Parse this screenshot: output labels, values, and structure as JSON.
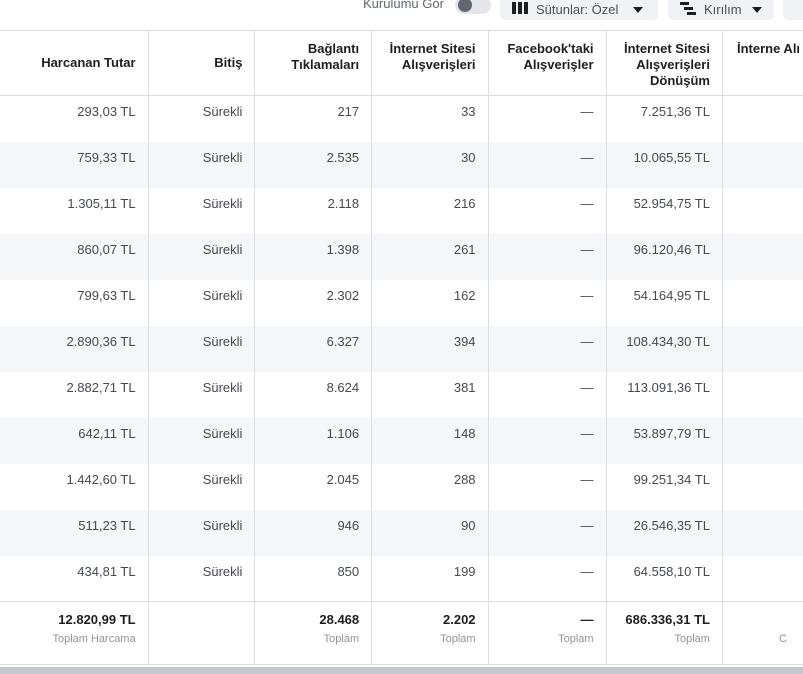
{
  "toolbar": {
    "setup_label": "Kurulumu Gör",
    "columns_label": "Sütunlar: Özel",
    "breakdown_label": "Kırılım",
    "columns_icon": "columns-icon",
    "breakdown_icon": "breakdown-icon"
  },
  "table": {
    "headers": [
      "Harcanan Tutar",
      "Bitiş",
      "Bağlantı Tıklamaları",
      "İnternet Sitesi Alışverişleri",
      "Facebook'taki Alışverişler",
      "İnternet Sitesi Alışverişleri Dönüşüm",
      "İnterne Alı F"
    ],
    "rows": [
      [
        "293,03 TL",
        "Sürekli",
        "217",
        "33",
        "—",
        "7.251,36 TL",
        ""
      ],
      [
        "759,33 TL",
        "Sürekli",
        "2.535",
        "30",
        "—",
        "10.065,55 TL",
        ""
      ],
      [
        "1.305,11 TL",
        "Sürekli",
        "2.118",
        "216",
        "—",
        "52.954,75 TL",
        ""
      ],
      [
        "860,07 TL",
        "Sürekli",
        "1.398",
        "261",
        "—",
        "96.120,46 TL",
        ""
      ],
      [
        "799,63 TL",
        "Sürekli",
        "2.302",
        "162",
        "—",
        "54.164,95 TL",
        ""
      ],
      [
        "2.890,36 TL",
        "Sürekli",
        "6.327",
        "394",
        "—",
        "108.434,30 TL",
        ""
      ],
      [
        "2.882,71 TL",
        "Sürekli",
        "8.624",
        "381",
        "—",
        "113.091,36 TL",
        ""
      ],
      [
        "642,11 TL",
        "Sürekli",
        "1.106",
        "148",
        "—",
        "53.897,79 TL",
        ""
      ],
      [
        "1.442,60 TL",
        "Sürekli",
        "2.045",
        "288",
        "—",
        "99.251,34 TL",
        ""
      ],
      [
        "511,23 TL",
        "Sürekli",
        "946",
        "90",
        "—",
        "26.546,35 TL",
        ""
      ],
      [
        "434,81 TL",
        "Sürekli",
        "850",
        "199",
        "—",
        "64.558,10 TL",
        ""
      ]
    ],
    "totals": [
      {
        "value": "12.820,99 TL",
        "label": "Toplam Harcama"
      },
      {
        "value": "",
        "label": ""
      },
      {
        "value": "28.468",
        "label": "Toplam"
      },
      {
        "value": "2.202",
        "label": "Toplam"
      },
      {
        "value": "—",
        "label": "Toplam"
      },
      {
        "value": "686.336,31 TL",
        "label": "Toplam"
      },
      {
        "value": "",
        "label": "C"
      }
    ]
  }
}
